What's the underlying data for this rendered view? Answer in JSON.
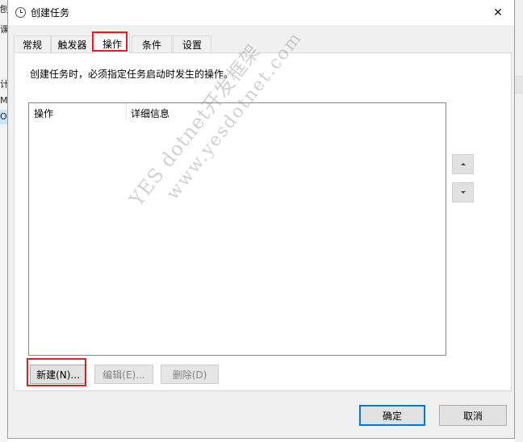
{
  "window": {
    "title": "创建任务",
    "close_glyph": "✕"
  },
  "tabs": [
    {
      "label": "常规"
    },
    {
      "label": "触发器"
    },
    {
      "label": "操作"
    },
    {
      "label": "条件"
    },
    {
      "label": "设置"
    }
  ],
  "active_tab": "操作",
  "panel": {
    "description": "创建任务时，必须指定任务启动时发生的操作。",
    "list_columns": [
      "操作",
      "详细信息"
    ]
  },
  "buttons": {
    "new": "新建(N)...",
    "edit": "编辑(E)...",
    "delete": "删除(D)",
    "ok": "确定",
    "cancel": "取消"
  },
  "watermark": {
    "line1": "YES dotnet开发框架",
    "line2": "www.yesdotnet.com"
  },
  "background_fragments": [
    "刨",
    "课",
    "计",
    "M",
    "Or"
  ],
  "colors": {
    "highlight_box": "#e02020",
    "default_button_border": "#0078d7"
  }
}
